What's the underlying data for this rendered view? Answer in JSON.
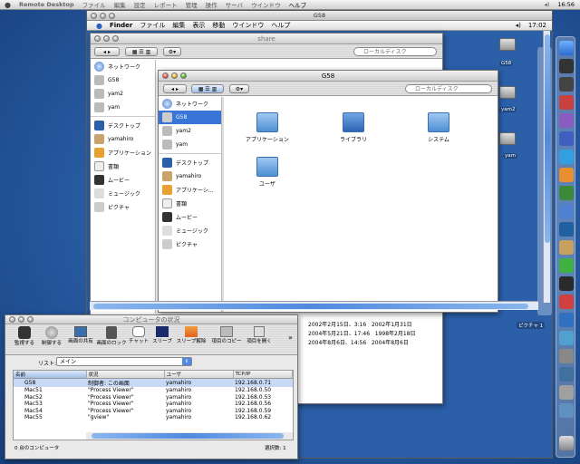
{
  "host_menubar": {
    "app": "Remote Desktop",
    "items": [
      "ファイル",
      "編集",
      "設定",
      "レポート",
      "管理",
      "操作",
      "サーバ",
      "ウインドウ",
      "ヘルプ"
    ],
    "clock": "16:56"
  },
  "remote_window": {
    "title": "G58"
  },
  "mac_menubar": {
    "app": "Finder",
    "items": [
      "ファイル",
      "編集",
      "表示",
      "移動",
      "ウインドウ",
      "ヘルプ"
    ],
    "clock": "17:02"
  },
  "finder_back": {
    "title": "share",
    "search_placeholder": "ローカルディスク",
    "sidebar": [
      "ネットワーク",
      "G58",
      "yam2",
      "yam",
      "デスクトップ",
      "yamahiro",
      "アプリケーション",
      "書類",
      "ムービー",
      "ミュージック",
      "ピクチャ"
    ],
    "rows": [
      {
        "date1": "2002年2月15日、3:16",
        "date2": "2002年1月31日"
      },
      {
        "date1": "2004年5月21日、17:46",
        "date2": "1998年2月18日"
      },
      {
        "date1": "2004年8月6日、14:56",
        "date2": "2004年8月6日"
      }
    ]
  },
  "finder_front": {
    "title": "G58",
    "search_placeholder": "ローカルディスク",
    "sidebar": [
      {
        "label": "ネットワーク",
        "icon": "globe-icon"
      },
      {
        "label": "G58",
        "icon": "disk-icon",
        "selected": true
      },
      {
        "label": "yam2",
        "icon": "disk-icon"
      },
      {
        "label": "yam",
        "icon": "disk-icon"
      },
      {
        "label": "デスクトップ",
        "icon": "desktop-icon"
      },
      {
        "label": "yamahiro",
        "icon": "home-icon"
      },
      {
        "label": "アプリケーシ...",
        "icon": "applications-icon"
      },
      {
        "label": "書類",
        "icon": "documents-icon"
      },
      {
        "label": "ムービー",
        "icon": "movies-icon"
      },
      {
        "label": "ミュージック",
        "icon": "music-icon"
      },
      {
        "label": "ピクチャ",
        "icon": "pictures-icon"
      }
    ],
    "folders": [
      "アプリケーション",
      "ライブラリ",
      "システム",
      "ユーザ"
    ]
  },
  "remote_app": {
    "title": "コンピュータの状況",
    "toolbar": [
      "監視する",
      "制御する",
      "画面の共有",
      "画面のロック",
      "チャット",
      "スリープ",
      "スリープ解除",
      "項目のコピー",
      "項目を開く"
    ],
    "list_label": "リスト:",
    "list_value": "メイン",
    "columns": [
      "名前",
      "状況",
      "ユーザ",
      "TCP/IP"
    ],
    "rows": [
      {
        "name": "G58",
        "status": "制御者: この画面",
        "user": "yamahiro",
        "ip": "192.168.0.71",
        "selected": true
      },
      {
        "name": "Mac51",
        "status": "\"Process Viewer\"",
        "user": "yamahiro",
        "ip": "192.168.0.50"
      },
      {
        "name": "Mac52",
        "status": "\"Process Viewer\"",
        "user": "yamahiro",
        "ip": "192.168.0.53"
      },
      {
        "name": "Mac53",
        "status": "\"Process Viewer\"",
        "user": "yamahiro",
        "ip": "192.168.0.56"
      },
      {
        "name": "Mac54",
        "status": "\"Process Viewer\"",
        "user": "yamahiro",
        "ip": "192.168.0.59"
      },
      {
        "name": "Mac55",
        "status": "\"gview\"",
        "user": "yamahiro",
        "ip": "192.168.0.62"
      }
    ],
    "status_left": "0 台のコンピュータ",
    "status_right": "選択数: 1"
  },
  "desktop_icons": [
    "G58",
    "yam2",
    "yam",
    "ピクチャ 1"
  ]
}
